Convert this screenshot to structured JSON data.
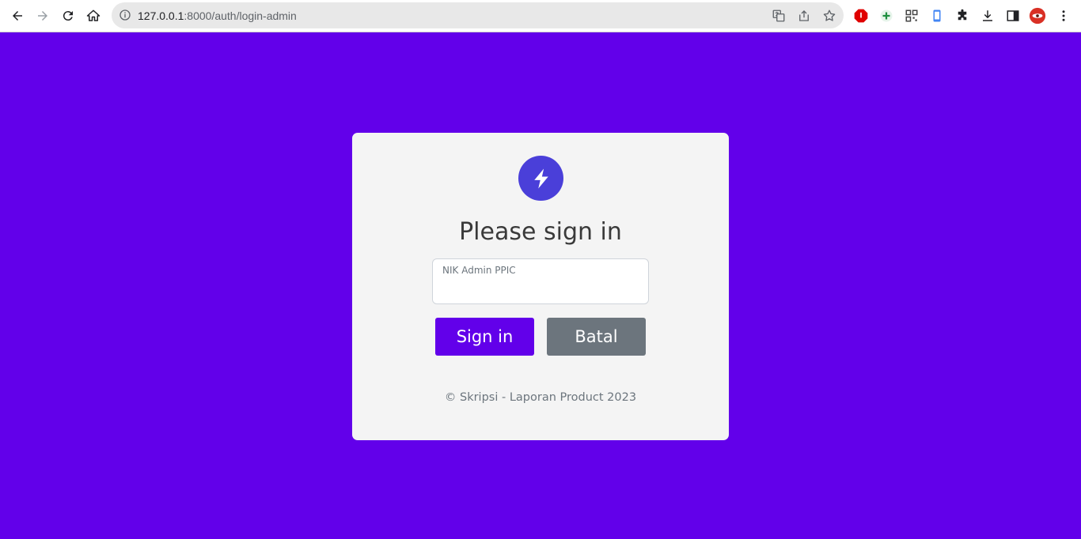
{
  "browser": {
    "url_host": "127.0.0.1",
    "url_path": ":8000/auth/login-admin"
  },
  "login": {
    "title": "Please sign in",
    "field_label": "NIK Admin PPIC",
    "field_value": "",
    "sign_in_label": "Sign in",
    "cancel_label": "Batal",
    "footer": "© Skripsi - Laporan Product 2023"
  },
  "colors": {
    "page_background": "#6200ea",
    "card_background": "#f4f4f4",
    "logo": "#4a3fd9",
    "primary_button": "#6200ea",
    "secondary_button": "#6c757d"
  },
  "icons": [
    "back-icon",
    "forward-icon",
    "reload-icon",
    "home-icon",
    "info-icon",
    "translate-icon",
    "share-icon",
    "star-icon",
    "extensions-puzzle-icon",
    "download-icon",
    "side-panel-icon",
    "profile-avatar",
    "menu-dots-icon",
    "bolt-icon"
  ]
}
